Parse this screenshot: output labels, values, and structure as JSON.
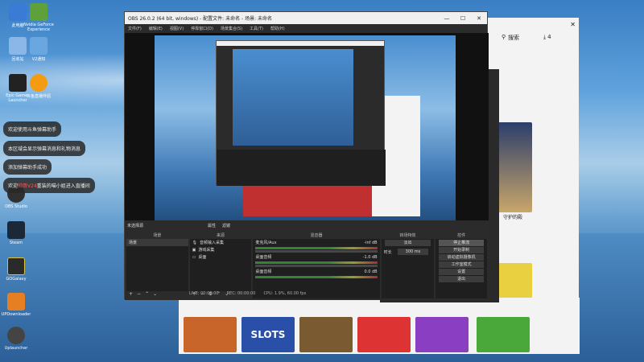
{
  "desktop": {
    "icons": [
      {
        "label": "此电脑",
        "color": "#3a7bd5"
      },
      {
        "label": "Nvidia GeForce Experience",
        "color": "#5ea13a"
      },
      {
        "label": "回收站",
        "color": "#8ab6e8"
      },
      {
        "label": "V2通知",
        "color": "#6aa6e0"
      },
      {
        "label": "Epic Games Launcher",
        "color": "#222222"
      },
      {
        "label": "斗鱼直播伴侣",
        "color": "#f39c12"
      },
      {
        "label": "OBS Studio",
        "color": "#303030"
      },
      {
        "label": "Steam",
        "color": "#1b2838"
      },
      {
        "label": "GOGalaxy",
        "color": "#2a2a2a"
      },
      {
        "label": "UPDownloader",
        "color": "#e67e22"
      },
      {
        "label": "Uplauncher",
        "color": "#444444"
      }
    ],
    "chat": [
      {
        "text": "欢迎使用斗鱼弹幕助手"
      },
      {
        "text": "本区域会显示弹幕消息和礼物消息"
      },
      {
        "text": "添加弹幕助手成功"
      },
      {
        "pre": "欢迎",
        "hl": "帅哥V24",
        "post": "重装的喵小姐进入直播间"
      }
    ]
  },
  "store": {
    "search_label": "搜索",
    "count": "4",
    "game_title": "守护的殿",
    "slots_label": "SLOTS"
  },
  "obs": {
    "title": "OBS 26.0.2 (64 bit, windows) - 配置文件: 未命名 - 场景: 未命名",
    "menu": [
      "文件(F)",
      "编辑(E)",
      "视图(V)",
      "停靠窗口(D)",
      "场景集合(S)",
      "工具(T)",
      "帮助(H)"
    ],
    "mid_label": "未选择源",
    "mid_tabs": [
      "属性",
      "滤镜"
    ],
    "panels": {
      "scenes": {
        "header": "场景",
        "items": [
          "场景"
        ]
      },
      "sources": {
        "header": "来源",
        "items": [
          "音频输入采集",
          "游戏采集",
          "桌面"
        ]
      },
      "mixer": {
        "header": "混音器",
        "channels": [
          {
            "name": "麦克风/Aux",
            "db": "-inf dB"
          },
          {
            "name": "桌面音频",
            "db": "-1.0 dB"
          },
          {
            "name": "桌面音频",
            "db": "0.0 dB"
          }
        ]
      },
      "transitions": {
        "header": "转场特效",
        "effect": "淡出",
        "duration_label": "时长",
        "duration": "300 ms"
      },
      "controls": {
        "header": "控件",
        "buttons": [
          "停止推流",
          "开始录制",
          "启动虚拟摄像机",
          "工作室模式",
          "设置",
          "退出"
        ]
      }
    },
    "status": [
      "LIVE: 00:00:00",
      "REC: 00:00:00",
      "CPU: 1.9%, 60.00 fps"
    ]
  }
}
